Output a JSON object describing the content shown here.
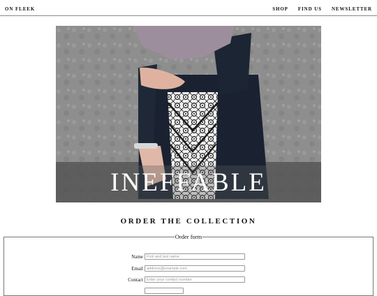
{
  "header": {
    "brand": "ON FLEEK",
    "nav": [
      "SHOP",
      "FIND US",
      "NEWSLETTER"
    ]
  },
  "hero": {
    "title": "INEFFABLE"
  },
  "section": {
    "title": "ORDER THE COLLECTION"
  },
  "form": {
    "legend": "Order form",
    "fields": [
      {
        "label": "Name",
        "placeholder": "First and last name"
      },
      {
        "label": "Email",
        "placeholder": "address@example.com"
      },
      {
        "label": "Contact",
        "placeholder": "Enter your contact number"
      },
      {
        "label": "",
        "placeholder": ""
      }
    ]
  },
  "colors": {
    "hijab": "#9d8e9d",
    "dress": "#1a2231",
    "wall": "#8f8f8f"
  }
}
